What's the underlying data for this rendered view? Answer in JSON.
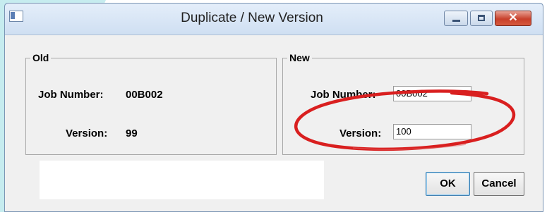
{
  "window": {
    "title": "Duplicate / New Version",
    "icons": {
      "app": "app-icon",
      "minimize": "minimize-icon",
      "maximize": "maximize-icon",
      "close": "close-icon"
    },
    "close_glyph": "✕"
  },
  "old": {
    "legend": "Old",
    "job_number_label": "Job Number:",
    "job_number_value": "00B002",
    "version_label": "Version:",
    "version_value": "99"
  },
  "new": {
    "legend": "New",
    "job_number_label": "Job Number:",
    "job_number_value": "00B002",
    "version_label": "Version:",
    "version_value": "100"
  },
  "buttons": {
    "ok": "OK",
    "cancel": "Cancel"
  },
  "colors": {
    "highlight_circle": "#d91f1f",
    "background_deco": "#c6ecef"
  }
}
